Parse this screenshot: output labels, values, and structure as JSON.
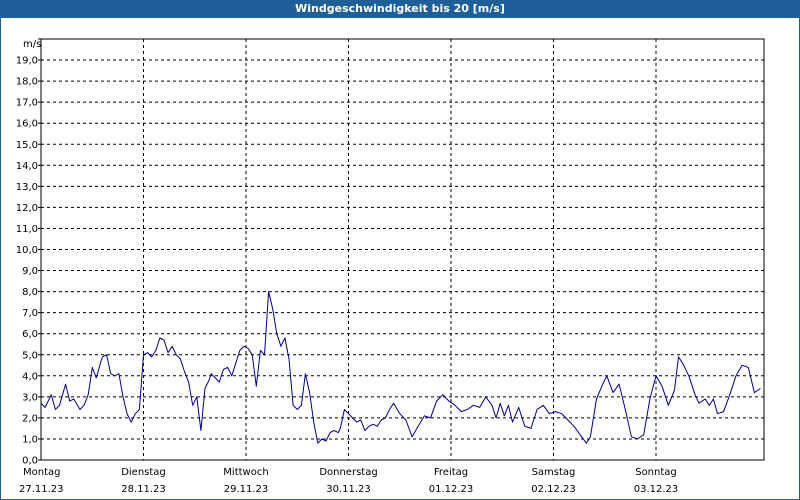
{
  "title": "Windgeschwindigkeit bis 20 [m/s]",
  "colors": {
    "titlebar": "#1f5f99",
    "line": "#00008b",
    "grid": "#000000"
  },
  "chart_data": {
    "type": "line",
    "title": "Windgeschwindigkeit bis 20 [m/s]",
    "ylabel": "m/s",
    "ylim": [
      0,
      20
    ],
    "ytick_labels": [
      "0,0",
      "1,0",
      "2,0",
      "3,0",
      "4,0",
      "5,0",
      "6,0",
      "7,0",
      "8,0",
      "9,0",
      "10,0",
      "11,0",
      "12,0",
      "13,0",
      "14,0",
      "15,0",
      "16,0",
      "17,0",
      "18,0",
      "19,0"
    ],
    "grid": true,
    "days": [
      {
        "day": "Montag",
        "date": "27.11.23"
      },
      {
        "day": "Dienstag",
        "date": "28.11.23"
      },
      {
        "day": "Mittwoch",
        "date": "29.11.23"
      },
      {
        "day": "Donnerstag",
        "date": "30.11.23"
      },
      {
        "day": "Freitag",
        "date": "01.12.23"
      },
      {
        "day": "Samstag",
        "date": "02.12.23"
      },
      {
        "day": "Sonntag",
        "date": "03.12.23"
      }
    ],
    "series": [
      {
        "x_days": [
          0.0,
          0.04,
          0.1,
          0.14,
          0.18,
          0.24,
          0.28,
          0.32,
          0.38,
          0.42,
          0.46,
          0.5,
          0.54,
          0.58,
          0.6,
          0.64,
          0.68,
          0.72,
          0.76,
          0.8,
          0.84,
          0.88,
          0.92,
          0.96,
          1.0,
          1.04,
          1.08,
          1.12,
          1.16,
          1.2,
          1.24,
          1.28,
          1.32,
          1.36,
          1.4,
          1.44,
          1.48,
          1.52,
          1.56,
          1.6,
          1.64,
          1.66,
          1.7,
          1.74,
          1.78,
          1.82,
          1.86,
          1.9,
          1.94,
          1.98,
          2.02,
          2.06,
          2.1,
          2.14,
          2.18,
          2.22,
          2.26,
          2.3,
          2.34,
          2.38,
          2.42,
          2.46,
          2.5,
          2.54,
          2.58,
          2.62,
          2.66,
          2.7,
          2.74,
          2.78,
          2.82,
          2.86,
          2.9,
          2.92,
          2.96,
          3.0,
          3.04,
          3.08,
          3.12,
          3.16,
          3.2,
          3.24,
          3.28,
          3.32,
          3.36,
          3.4,
          3.44,
          3.5,
          3.56,
          3.62,
          3.68,
          3.74,
          3.8,
          3.86,
          3.92,
          3.98,
          4.04,
          4.1,
          4.16,
          4.22,
          4.28,
          4.34,
          4.4,
          4.44,
          4.48,
          4.52,
          4.56,
          4.6,
          4.66,
          4.72,
          4.78,
          4.84,
          4.9,
          4.96,
          5.02,
          5.08,
          5.14,
          5.2,
          5.26,
          5.32,
          5.36,
          5.42,
          5.48,
          5.52,
          5.58,
          5.64,
          5.7,
          5.76,
          5.82,
          5.88,
          5.94,
          6.0,
          6.06,
          6.12,
          6.18,
          6.22,
          6.26,
          6.32,
          6.38,
          6.42,
          6.48,
          6.52,
          6.56,
          6.6,
          6.66,
          6.72,
          6.78,
          6.84,
          6.9,
          6.96,
          7.02,
          7.08,
          7.14,
          7.2
        ],
        "values": [
          2.7,
          2.5,
          3.1,
          2.4,
          2.6,
          3.6,
          2.8,
          2.9,
          2.4,
          2.6,
          3.1,
          4.4,
          3.9,
          4.6,
          4.9,
          5.0,
          4.1,
          4.0,
          4.1,
          3.0,
          2.2,
          1.8,
          2.2,
          2.4,
          5.0,
          5.1,
          4.9,
          5.2,
          5.8,
          5.7,
          5.1,
          5.4,
          5.0,
          4.8,
          4.2,
          3.7,
          2.6,
          3.0,
          1.4,
          3.4,
          3.8,
          4.1,
          3.9,
          3.7,
          4.3,
          4.4,
          4.0,
          4.6,
          5.2,
          5.4,
          5.3,
          5.0,
          3.5,
          5.2,
          5.0,
          8.0,
          7.2,
          6.0,
          5.4,
          5.8,
          4.8,
          2.6,
          2.4,
          2.6,
          4.1,
          3.2,
          1.8,
          0.8,
          1.0,
          0.9,
          1.3,
          1.4,
          1.3,
          1.5,
          2.4,
          2.2,
          2.0,
          1.8,
          1.9,
          1.4,
          1.6,
          1.7,
          1.6,
          1.9,
          2.0,
          2.4,
          2.7,
          2.2,
          1.9,
          1.1,
          1.6,
          2.1,
          2.0,
          2.8,
          3.1,
          2.8,
          2.6,
          2.3,
          2.4,
          2.6,
          2.5,
          3.0,
          2.6,
          2.0,
          2.7,
          2.1,
          2.6,
          1.8,
          2.5,
          1.6,
          1.5,
          2.4,
          2.6,
          2.2,
          2.3,
          2.2,
          1.9,
          1.6,
          1.2,
          0.8,
          1.1,
          2.9,
          3.6,
          4.0,
          3.2,
          3.6,
          2.4,
          1.1,
          1.0,
          1.2,
          2.9,
          4.0,
          3.5,
          2.6,
          3.3,
          4.9,
          4.6,
          4.0,
          3.1,
          2.7,
          2.9,
          2.6,
          2.9,
          2.2,
          2.3,
          3.1,
          4.0,
          4.5,
          4.4,
          3.2,
          3.4
        ]
      }
    ]
  }
}
